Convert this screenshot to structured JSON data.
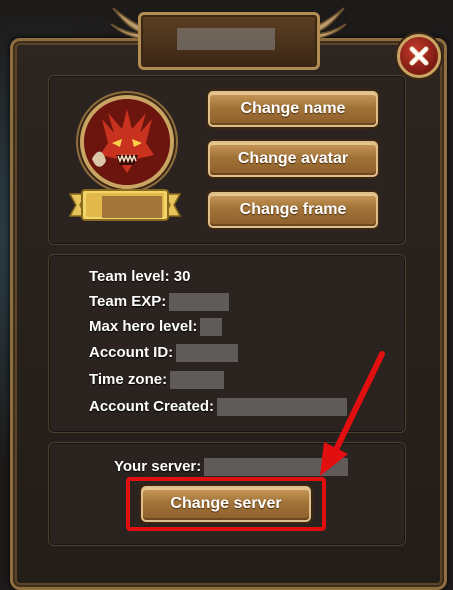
{
  "header": {
    "title": ""
  },
  "profile": {
    "name": ""
  },
  "buttons": {
    "change_name": "Change name",
    "change_avatar": "Change avatar",
    "change_frame": "Change frame",
    "change_server": "Change server"
  },
  "info": {
    "team_level_label": "Team level:",
    "team_level_value": "30",
    "team_exp_label": "Team EXP:",
    "max_hero_level_label": "Max hero level:",
    "account_id_label": "Account ID:",
    "time_zone_label": "Time zone:",
    "account_created_label": "Account Created:"
  },
  "server": {
    "label": "Your server:"
  },
  "icons": {
    "close": "close-icon",
    "avatar": "dragon-avatar-icon",
    "arrow": "red-arrow-icon"
  },
  "colors": {
    "gold": "#c99a5a",
    "highlight": "#e10f0f",
    "panel": "#2a231f"
  }
}
